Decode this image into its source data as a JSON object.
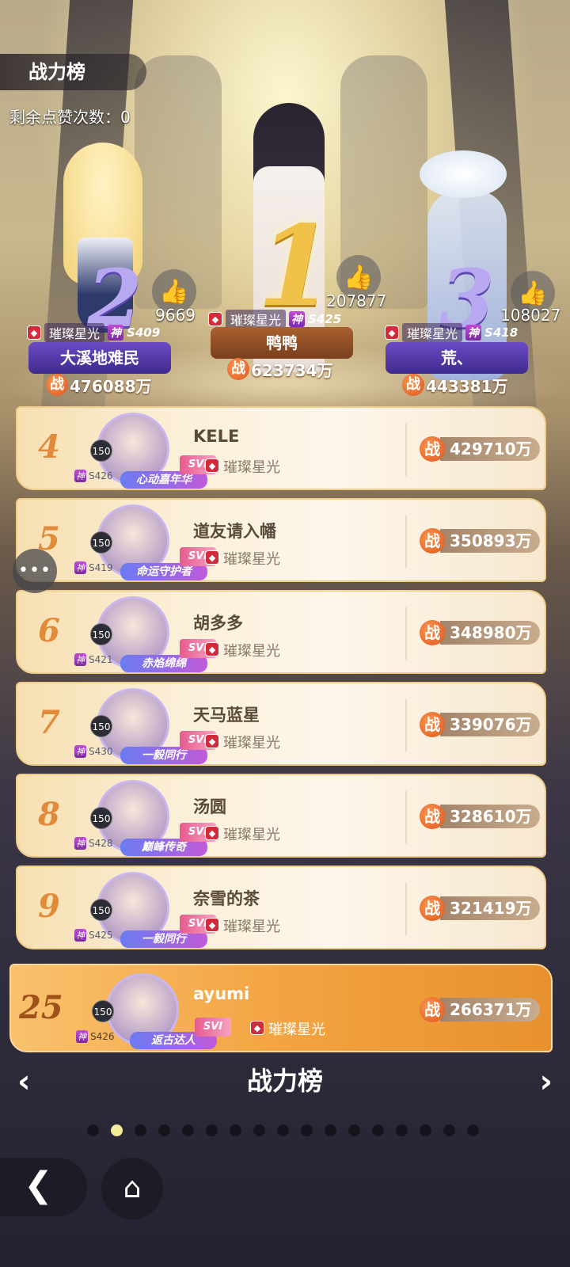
{
  "header": {
    "title": "战力榜",
    "likes_label": "剩余点赞次数：0"
  },
  "podium": [
    {
      "rank": "2",
      "likes": "9669",
      "guild": "璀璨星光",
      "tier": "神",
      "server": "S409",
      "name": "大溪地难民",
      "power_label": "战",
      "power": "476088万"
    },
    {
      "rank": "1",
      "likes": "207877",
      "guild": "璀璨星光",
      "tier": "神",
      "server": "S425",
      "name": "鸭鸭",
      "power_label": "战",
      "power": "623734万"
    },
    {
      "rank": "3",
      "likes": "108027",
      "guild": "璀璨星光",
      "tier": "神",
      "server": "S418",
      "name": "荒、",
      "power_label": "战",
      "power": "443381万"
    }
  ],
  "rows": [
    {
      "rank": "4",
      "level": "150",
      "tier": "神",
      "server": "S426",
      "title": "心动嘉年华",
      "name": "KELE",
      "vip": "SVI",
      "guild": "璀璨星光",
      "power": "429710万"
    },
    {
      "rank": "5",
      "level": "150",
      "tier": "神",
      "server": "S419",
      "title": "命运守护者",
      "name": "道友请入幡",
      "vip": "SVI",
      "guild": "璀璨星光",
      "power": "350893万"
    },
    {
      "rank": "6",
      "level": "150",
      "tier": "神",
      "server": "S421",
      "title": "赤焰绵绵",
      "name": "胡多多",
      "vip": "SVI",
      "guild": "璀璨星光",
      "power": "348980万"
    },
    {
      "rank": "7",
      "level": "150",
      "tier": "神",
      "server": "S430",
      "title": "一毅同行",
      "name": "天马蓝星",
      "vip": "SVI",
      "guild": "璀璨星光",
      "power": "339076万"
    },
    {
      "rank": "8",
      "level": "150",
      "tier": "神",
      "server": "S428",
      "title": "巅峰传奇",
      "name": "汤圆",
      "vip": "SVI",
      "guild": "璀璨星光",
      "power": "328610万"
    },
    {
      "rank": "9",
      "level": "150",
      "tier": "神",
      "server": "S425",
      "title": "一毅同行",
      "name": "奈雪的茶",
      "vip": "SVI",
      "guild": "璀璨星光",
      "power": "321419万"
    }
  ],
  "self": {
    "rank": "25",
    "level": "150",
    "tier": "神",
    "server": "S426",
    "title": "返古达人",
    "name": "ayumi",
    "vip": "SVI",
    "guild": "璀璨星光",
    "power": "266371万"
  },
  "power_label": "战",
  "footer": {
    "board_title": "战力榜",
    "left_arrow": "‹",
    "right_arrow": "›",
    "page_count": 17,
    "active_page": 2
  },
  "icons": {
    "like": "thumbs-up-icon",
    "chat": "chat-icon",
    "back": "back-icon",
    "home": "home-icon"
  },
  "colors": {
    "accent": "#e08a3a",
    "purple_bar": "#5235a8",
    "self_row": "#f3a442"
  }
}
